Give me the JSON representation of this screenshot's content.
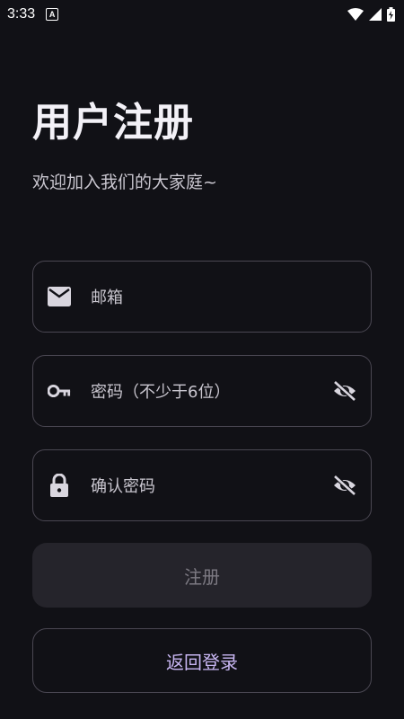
{
  "status_bar": {
    "time": "3:33",
    "notification_letter": "A"
  },
  "header": {
    "title": "用户注册",
    "subtitle": "欢迎加入我们的大家庭~"
  },
  "form": {
    "email_label": "邮箱",
    "password_label": "密码（不少于6位）",
    "confirm_label": "确认密码"
  },
  "buttons": {
    "register_label": "注册",
    "back_label": "返回登录"
  },
  "colors": {
    "background": "#111116",
    "accent": "#c8b6f2",
    "border": "#4a4752",
    "disabled_button": "#25242b"
  },
  "icons": {
    "email": "email-icon",
    "password": "key-icon",
    "confirm": "lock-icon",
    "visibility": "visibility-off-icon"
  }
}
